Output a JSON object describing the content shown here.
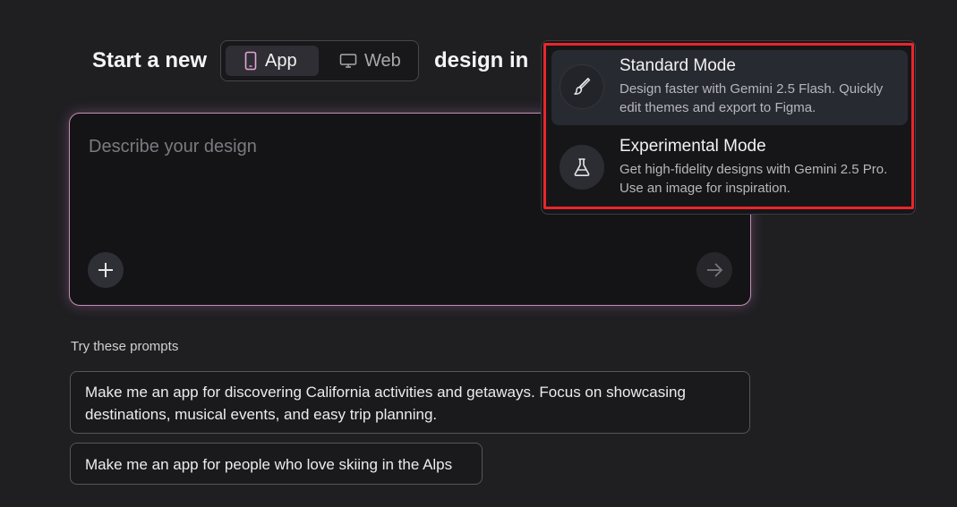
{
  "header": {
    "title_prefix": "Start a new",
    "title_suffix": "design in",
    "segments": [
      {
        "label": "App",
        "icon": "phone-icon",
        "selected": true
      },
      {
        "label": "Web",
        "icon": "monitor-icon",
        "selected": false
      }
    ]
  },
  "prompt": {
    "placeholder": "Describe your design",
    "value": ""
  },
  "suggestions": {
    "label": "Try these prompts",
    "items": [
      "Make me an app for discovering California activities and getaways. Focus on showcasing destinations, musical events, and easy trip planning.",
      "Make me an app for people who love skiing in the Alps"
    ]
  },
  "mode_menu": {
    "items": [
      {
        "title": "Standard Mode",
        "description": "Design faster with Gemini 2.5 Flash. Quickly edit themes and export to Figma.",
        "icon": "paintbrush-icon",
        "active": true
      },
      {
        "title": "Experimental Mode",
        "description": "Get high-fidelity designs with Gemini 2.5 Pro. Use an image for inspiration.",
        "icon": "flask-icon",
        "active": false
      }
    ]
  },
  "colors": {
    "background": "#1f1f22",
    "prompt_border": "#c28fb6",
    "highlight": "#e8262b",
    "app_icon_accent": "#e3a5d6"
  }
}
